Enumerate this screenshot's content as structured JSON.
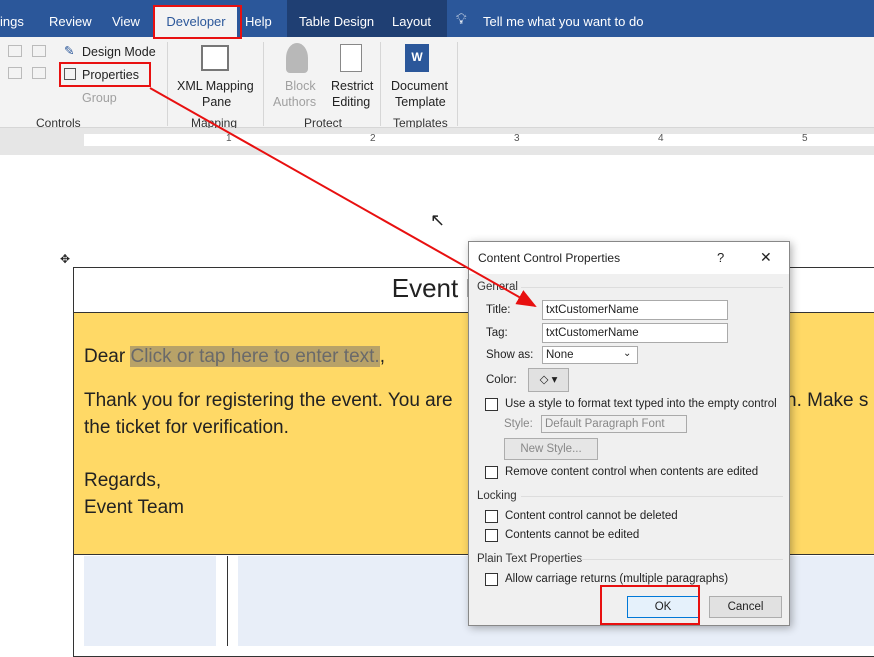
{
  "tabs": [
    "ings",
    "Review",
    "View",
    "Developer",
    "Help",
    "Table Design",
    "Layout"
  ],
  "tell_me": "Tell me what you want to do",
  "ribbon": {
    "design_mode": "Design Mode",
    "properties": "Properties",
    "group": "Group",
    "xml1": "XML Mapping",
    "xml2": "Pane",
    "block1": "Block",
    "block2": "Authors",
    "restrict1": "Restrict",
    "restrict2": "Editing",
    "doc1": "Document",
    "doc2": "Template",
    "groups": [
      "Controls",
      "Mapping",
      "Protect",
      "Templates"
    ]
  },
  "ruler": [
    "1",
    "2",
    "3",
    "4",
    "5"
  ],
  "document": {
    "title": "Event R",
    "greeting": "Dear ",
    "placeholder": "Click or tap here to enter text.",
    "comma": ",",
    "body1": "Thank you for registering the event. You are",
    "body1b": "n. Make s",
    "body2": "the ticket for verification.",
    "regards": "Regards,",
    "team": "Event Team"
  },
  "dialog": {
    "title": "Content Control Properties",
    "help": "?",
    "close": "✕",
    "general": "General",
    "title_label": "Title:",
    "title_value": "txtCustomerName",
    "tag_label": "Tag:",
    "tag_value": "txtCustomerName",
    "show_as_label": "Show as:",
    "show_as_value": "None",
    "color_label": "Color:",
    "use_style": "Use a style to format text typed into the empty control",
    "style_label": "Style:",
    "style_value": "Default Paragraph Font",
    "new_style": "New Style...",
    "remove": "Remove content control when contents are edited",
    "locking": "Locking",
    "no_delete": "Content control cannot be deleted",
    "no_edit": "Contents cannot be edited",
    "plain_text": "Plain Text Properties",
    "allow_cr": "Allow carriage returns (multiple paragraphs)",
    "ok": "OK",
    "cancel": "Cancel"
  },
  "colors": {
    "accent": "#2b579a",
    "highlight": "#ffd966",
    "annotation": "#e81010"
  }
}
